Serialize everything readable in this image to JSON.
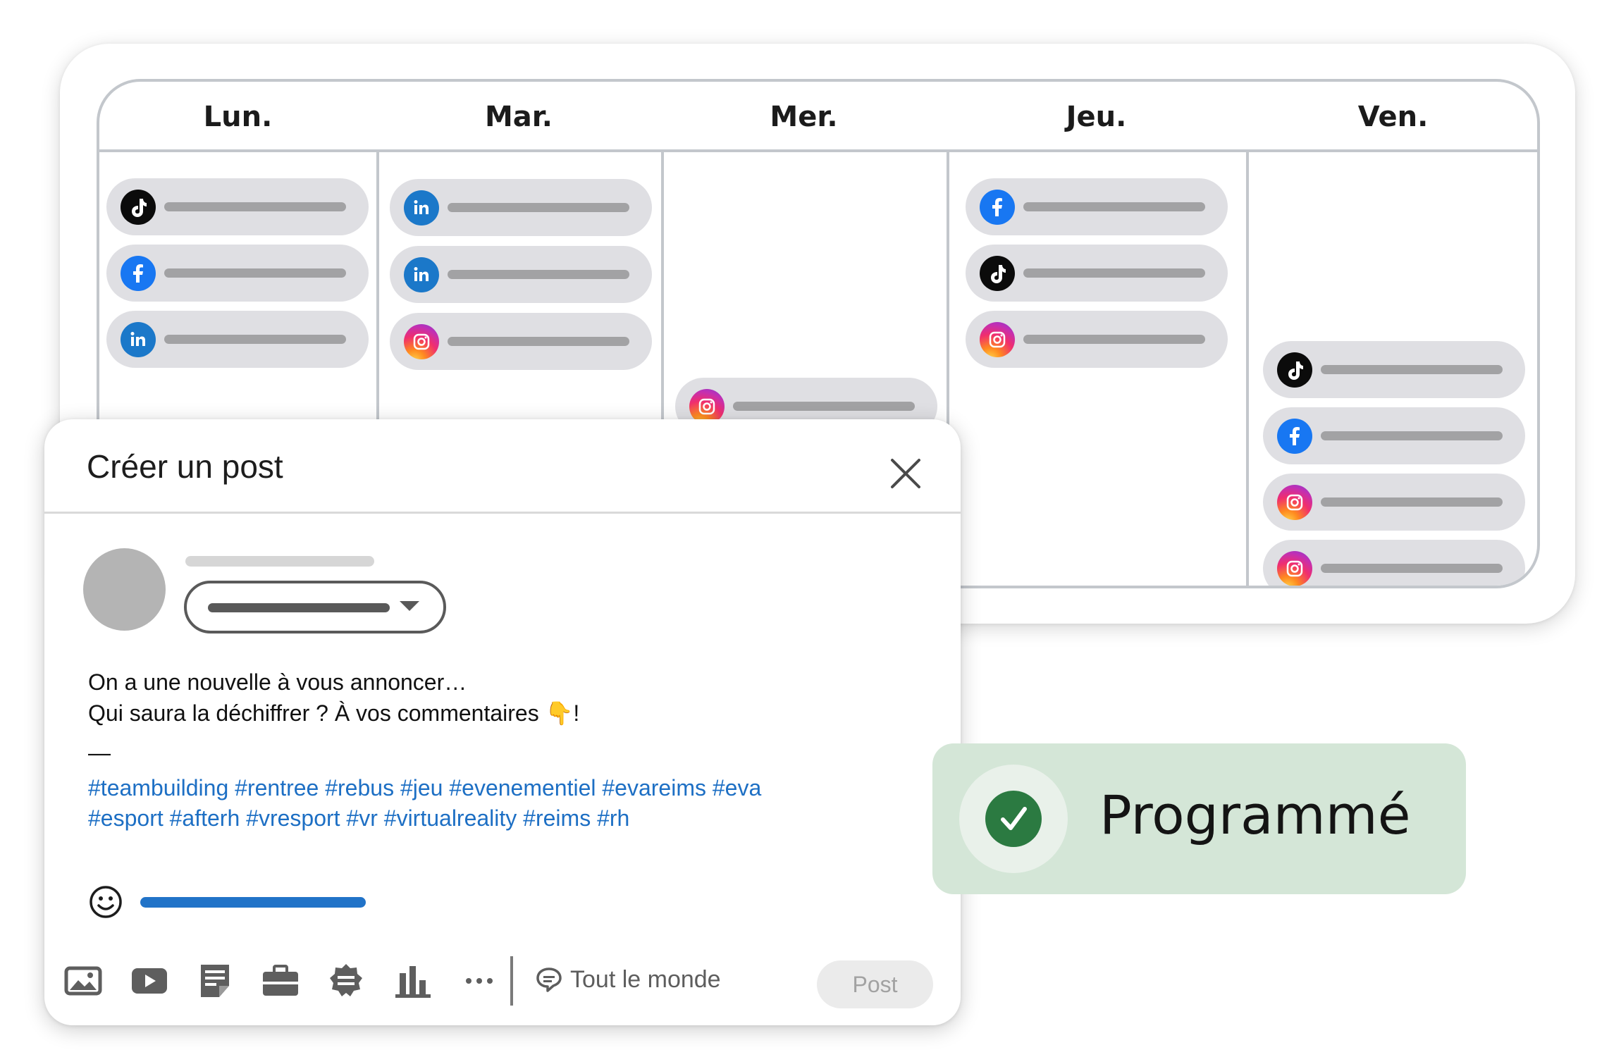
{
  "calendar": {
    "days": [
      {
        "label": "Lun.",
        "posts": [
          "tiktok",
          "facebook",
          "linkedin"
        ]
      },
      {
        "label": "Mar.",
        "posts": [
          "linkedin",
          "linkedin",
          "instagram"
        ]
      },
      {
        "label": "Mer.",
        "posts": [
          "instagram"
        ]
      },
      {
        "label": "Jeu.",
        "posts": [
          "facebook",
          "tiktok",
          "instagram"
        ]
      },
      {
        "label": "Ven.",
        "posts": [
          "tiktok",
          "facebook",
          "instagram",
          "instagram"
        ]
      }
    ]
  },
  "dialog": {
    "title": "Créer un post",
    "close_icon": "close-icon",
    "text_line1": "On a une nouvelle à vous annoncer…",
    "text_line2": "Qui saura la déchiffrer ? À vos commentaires 👇!",
    "separator": "—",
    "hashtags_line1": "#teambuilding #rentree #rebus #jeu #evenementiel #evareims #eva",
    "hashtags_line2": "#esport #afterh #vresport #vr #virtualreality #reims #rh",
    "toolbar_icons": [
      "photo-icon",
      "video-icon",
      "document-icon",
      "briefcase-icon",
      "badge-icon",
      "chart-icon",
      "more-icon"
    ],
    "audience_label": "Tout le monde",
    "post_button": "Post"
  },
  "status": {
    "label": "Programmé",
    "color": "#2b7a41",
    "background": "#d4e6d7"
  }
}
